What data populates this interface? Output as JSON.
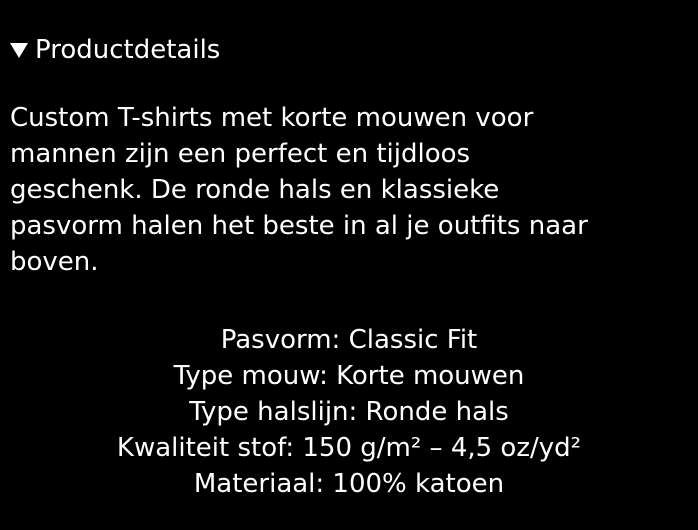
{
  "details": {
    "summary_label": "Productdetails",
    "toggle_icon": "triangle-down-icon",
    "expanded": true
  },
  "description_lines": [
    "Custom T-shirts met korte mouwen voor",
    "mannen zijn een perfect en tijdloos",
    "geschenk. De ronde hals en klassieke",
    "pasvorm halen het beste in al je outfits naar",
    "boven."
  ],
  "specs": [
    "Pasvorm: Classic Fit",
    "Type mouw: Korte mouwen",
    "Type halslijn: Ronde hals",
    "Kwaliteit stof: 150 g/m² – 4,5 oz/yd²",
    "Materiaal: 100% katoen"
  ],
  "colors": {
    "background": "#000000",
    "text": "#ffffff"
  }
}
